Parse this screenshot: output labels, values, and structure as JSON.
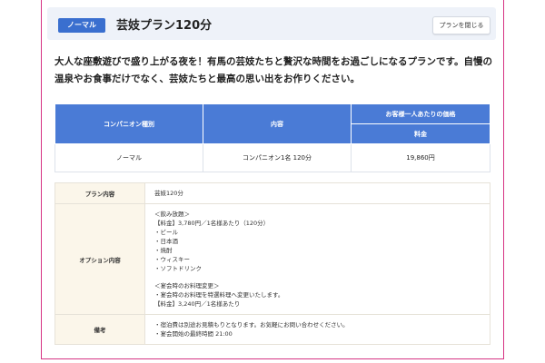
{
  "header": {
    "badge": "ノーマル",
    "title": "芸妓プラン120分",
    "close_label": "プランを閉じる"
  },
  "description": "大人な座敷遊びで盛り上がる夜を！有馬の芸妓たちと贅沢な時間をお過ごしになるプランです。自慢の温泉やお食事だけでなく、芸妓たちと最高の思い出をお作りください。",
  "price_table": {
    "headers": {
      "type": "コンパニオン種別",
      "content": "内容",
      "price_group": "お客様一人あたりの価格",
      "fee": "料金"
    },
    "rows": [
      {
        "type": "ノーマル",
        "content": "コンパニオン1名 120分",
        "fee": "19,860円"
      }
    ]
  },
  "details": {
    "plan": {
      "label": "プラン内容",
      "value": "芸妓120分"
    },
    "options": {
      "label": "オプション内容",
      "drinks": [
        "＜飲み放題＞",
        "【料金】3,780円／1名様あたり（120分）",
        "・ビール",
        "・日本酒",
        "・焼酎",
        "・ウィスキー",
        "・ソフトドリンク"
      ],
      "food": [
        "＜宴会時のお料理変更＞",
        "・宴会時のお料理を特選料理へ変更いたします。",
        "【料金】3,240円／1名様あたり"
      ]
    },
    "notes": {
      "label": "備考",
      "lines": [
        "・宿泊費は別途お見積もりとなります。お気軽にお問い合わせください。",
        "・宴会開始の最終時間 21:00"
      ]
    }
  },
  "colors": {
    "accent": "#3a6fcf",
    "table_header": "#4a7bd6",
    "header_bg": "#eef2f9",
    "detail_label_bg": "#fbf6ea",
    "frame_border": "#d63384"
  }
}
